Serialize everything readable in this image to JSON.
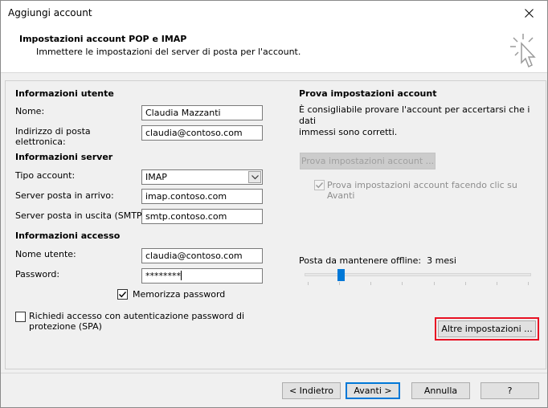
{
  "window": {
    "title": "Aggiungi account"
  },
  "header": {
    "title": "Impostazioni account POP e IMAP",
    "subtitle": "Immettere le impostazioni del server di posta per l'account."
  },
  "user_info": {
    "heading": "Informazioni utente",
    "name_label": "Nome:",
    "name_value": "Claudia Mazzanti",
    "email_label_1": "Indirizzo di posta",
    "email_label_2": "elettronica:",
    "email_value": "claudia@contoso.com"
  },
  "server_info": {
    "heading": "Informazioni server",
    "account_type_label": "Tipo account:",
    "account_type_value": "IMAP",
    "incoming_label": "Server posta in arrivo:",
    "incoming_value": "imap.contoso.com",
    "outgoing_label": "Server posta in uscita (SMTP):",
    "outgoing_value": "smtp.contoso.com"
  },
  "access_info": {
    "heading": "Informazioni accesso",
    "username_label": "Nome utente:",
    "username_value": "claudia@contoso.com",
    "password_label": "Password:",
    "password_value": "********",
    "remember_label": "Memorizza password",
    "remember_checked": true,
    "spa_label_1": "Richiedi accesso con autenticazione password di",
    "spa_label_2": "protezione (SPA)",
    "spa_checked": false
  },
  "test": {
    "heading": "Prova impostazioni account",
    "desc_1": "È consigliabile provare l'account per accertarsi che i dati",
    "desc_2": "immessi sono corretti.",
    "button": "Prova impostazioni account ...",
    "auto_label_1": "Prova impostazioni account facendo clic su",
    "auto_label_2": "Avanti",
    "auto_checked": true
  },
  "offline": {
    "label": "Posta da mantenere offline:",
    "value": "3 mesi",
    "slider_fraction": 0.15
  },
  "more_settings_button": "Altre impostazioni ...",
  "footer": {
    "back": "< Indietro",
    "next": "Avanti >",
    "cancel": "Annulla",
    "help": "?"
  },
  "colors": {
    "accent": "#0078d7",
    "highlight": "#e81123"
  }
}
